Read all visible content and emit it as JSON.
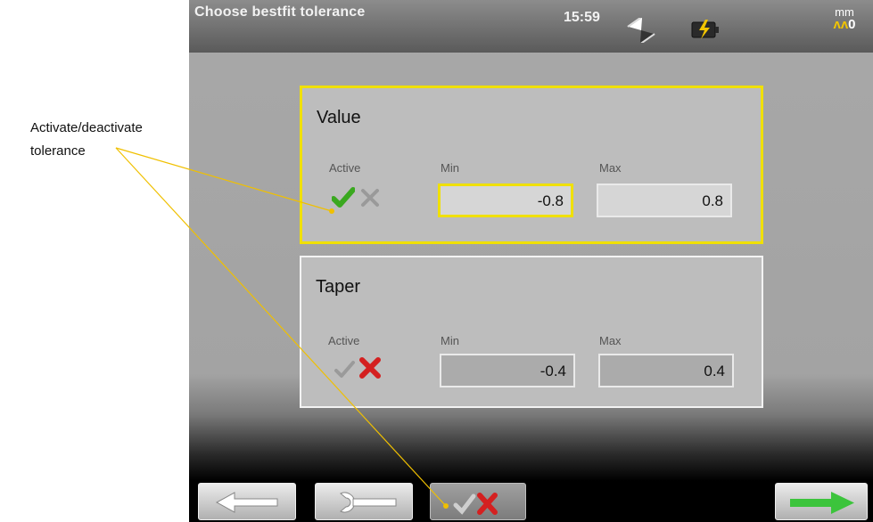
{
  "annotation": {
    "text": "Activate/deactivate tolerance"
  },
  "header": {
    "title": "Choose bestfit tolerance",
    "time": "15:59",
    "unit": "mm",
    "resolution": "0"
  },
  "panels": [
    {
      "title": "Value",
      "active_label": "Active",
      "min_label": "Min",
      "max_label": "Max",
      "min_value": "-0.8",
      "max_value": "0.8",
      "active": true
    },
    {
      "title": "Taper",
      "active_label": "Active",
      "min_label": "Min",
      "max_label": "Max",
      "min_value": "-0.4",
      "max_value": "0.4",
      "active": false
    }
  ],
  "colors": {
    "highlight": "#f0e000",
    "check_active": "#3aa81f",
    "cross_active": "#d42020",
    "next_arrow": "#3cc43c"
  },
  "icons": {
    "back": "arrow-left-icon",
    "wrench": "wrench-icon",
    "toggle": "check-cross-icon",
    "next": "arrow-right-icon"
  }
}
